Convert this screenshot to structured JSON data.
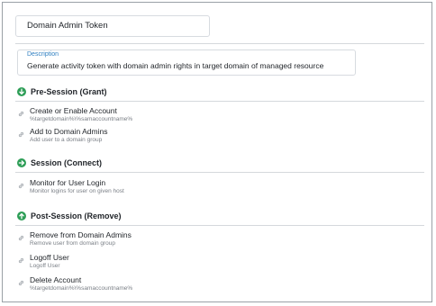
{
  "token_name": "Domain Admin Token",
  "description": {
    "label": "Description",
    "value": "Generate activity token with domain admin rights in target domain of managed resource"
  },
  "sections": [
    {
      "title": "Pre-Session (Grant)",
      "icon": "arrow-down-circle-icon",
      "items": [
        {
          "title": "Create or Enable Account",
          "subtitle": "%targetdomain%\\%samaccountname%"
        },
        {
          "title": "Add to Domain Admins",
          "subtitle": "Add user to a domain group"
        }
      ]
    },
    {
      "title": "Session (Connect)",
      "icon": "arrow-right-circle-icon",
      "items": [
        {
          "title": "Monitor for User Login",
          "subtitle": "Monitor logins for user on given host"
        }
      ]
    },
    {
      "title": "Post-Session (Remove)",
      "icon": "arrow-up-circle-icon",
      "items": [
        {
          "title": "Remove from Domain Admins",
          "subtitle": "Remove user from domain group"
        },
        {
          "title": "Logoff User",
          "subtitle": "Logoff User"
        },
        {
          "title": "Delete Account",
          "subtitle": "%targetdomain%\\%samaccountname%"
        }
      ]
    }
  ],
  "colors": {
    "section_icon": "#2e9e57",
    "description_label": "#2f7fc1",
    "subtitle_text": "#7a7f86",
    "divider": "#d5d8dc"
  }
}
